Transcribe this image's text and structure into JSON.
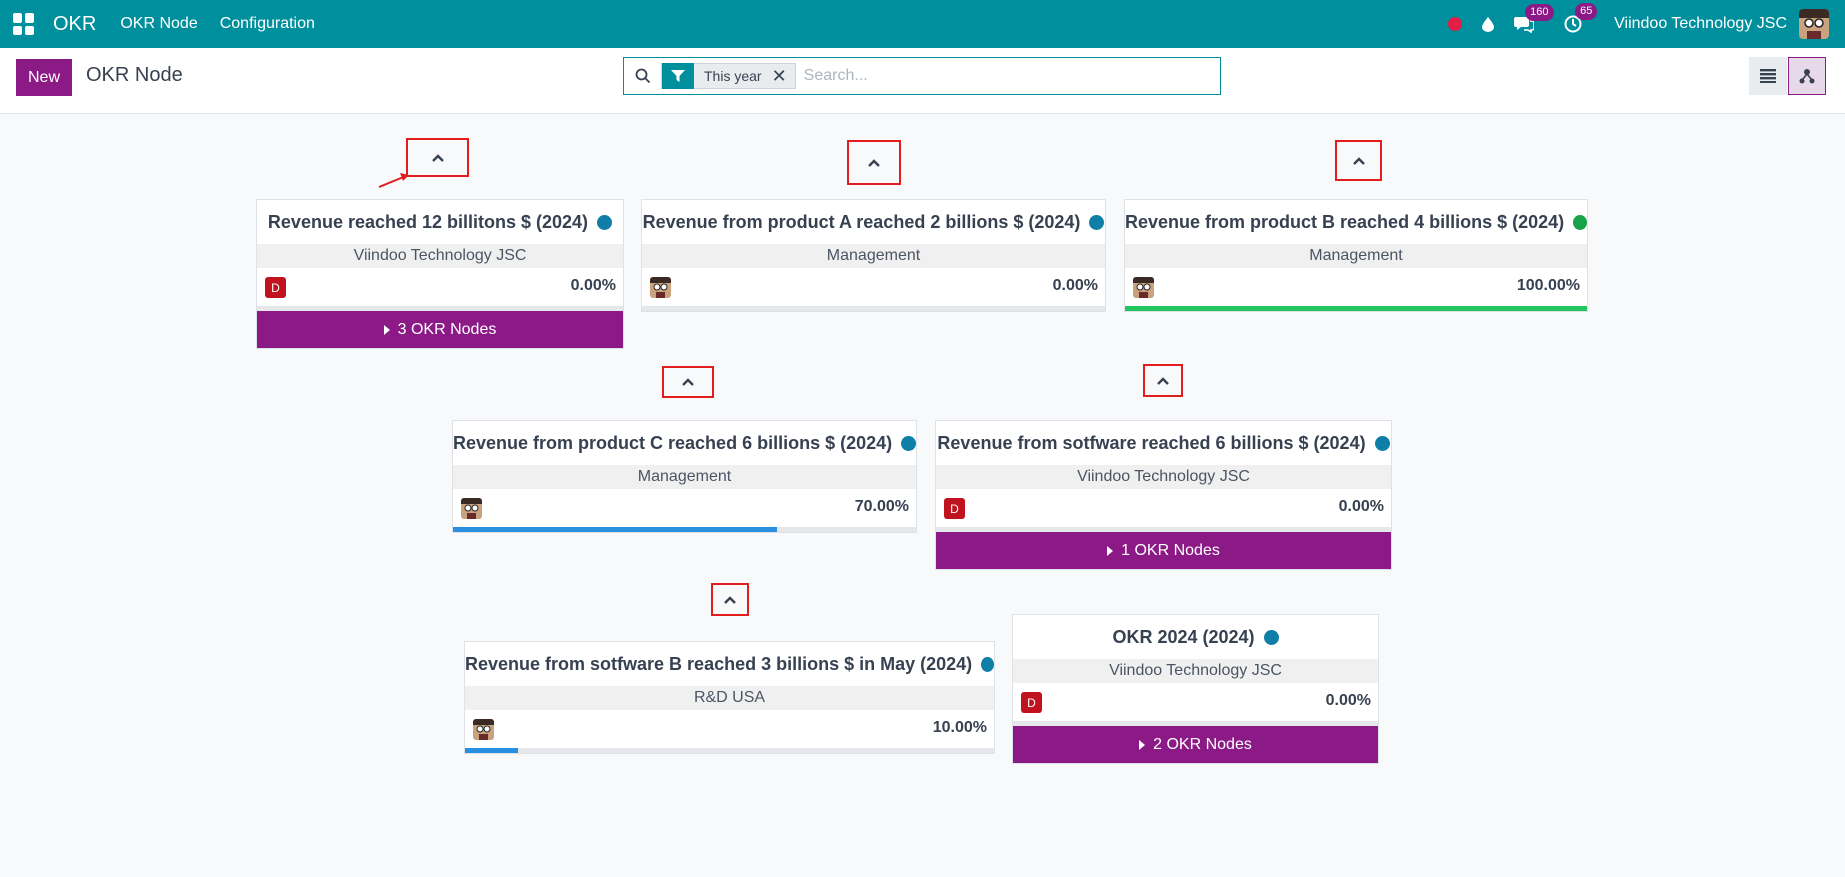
{
  "navbar": {
    "brand": "OKR",
    "menu": [
      "OKR Node",
      "Configuration"
    ],
    "messages_count": "160",
    "activities_count": "65",
    "company": "Viindoo Technology JSC"
  },
  "control": {
    "new_label": "New",
    "title": "OKR Node",
    "facet_label": "This year",
    "facet_close": "✕",
    "search_placeholder": "Search..."
  },
  "colors": {
    "primary": "#8b1a86",
    "navbar": "#008f9c",
    "blue_dot": "#0f7fa8",
    "green_dot": "#16a34a",
    "green_bar": "#22c55e",
    "blue_bar": "#2b8fe0",
    "avatar_d": "#c1121f"
  },
  "cards": [
    {
      "title": "Revenue reached 12 billitons $ (2024)",
      "status": "blue",
      "team": "Viindoo Technology JSC",
      "avatar": "D",
      "percent": "0.00%",
      "progress": 0,
      "children": "3 OKR Nodes"
    },
    {
      "title": "Revenue from product A reached 2 billions $ (2024)",
      "status": "blue",
      "team": "Management",
      "avatar": "face",
      "percent": "0.00%",
      "progress": 0,
      "children": ""
    },
    {
      "title": "Revenue from product B reached 4 billions $ (2024)",
      "status": "green",
      "team": "Management",
      "avatar": "face",
      "percent": "100.00%",
      "progress": 100,
      "children": ""
    },
    {
      "title": "Revenue from product C reached 6 billions $ (2024)",
      "status": "blue",
      "team": "Management",
      "avatar": "face",
      "percent": "70.00%",
      "progress": 70,
      "children": ""
    },
    {
      "title": "Revenue from sotfware reached 6 billions $ (2024)",
      "status": "blue",
      "team": "Viindoo Technology JSC",
      "avatar": "D",
      "percent": "0.00%",
      "progress": 0,
      "children": "1 OKR Nodes"
    },
    {
      "title": "Revenue from sotfware B reached 3 billions $ in May (2024)",
      "status": "blue",
      "team": "R&D USA",
      "avatar": "face",
      "percent": "10.00%",
      "progress": 10,
      "children": ""
    },
    {
      "title": "OKR 2024 (2024)",
      "status": "blue",
      "team": "Viindoo Technology JSC",
      "avatar": "D",
      "percent": "0.00%",
      "progress": 0,
      "children": "2 OKR Nodes"
    }
  ]
}
